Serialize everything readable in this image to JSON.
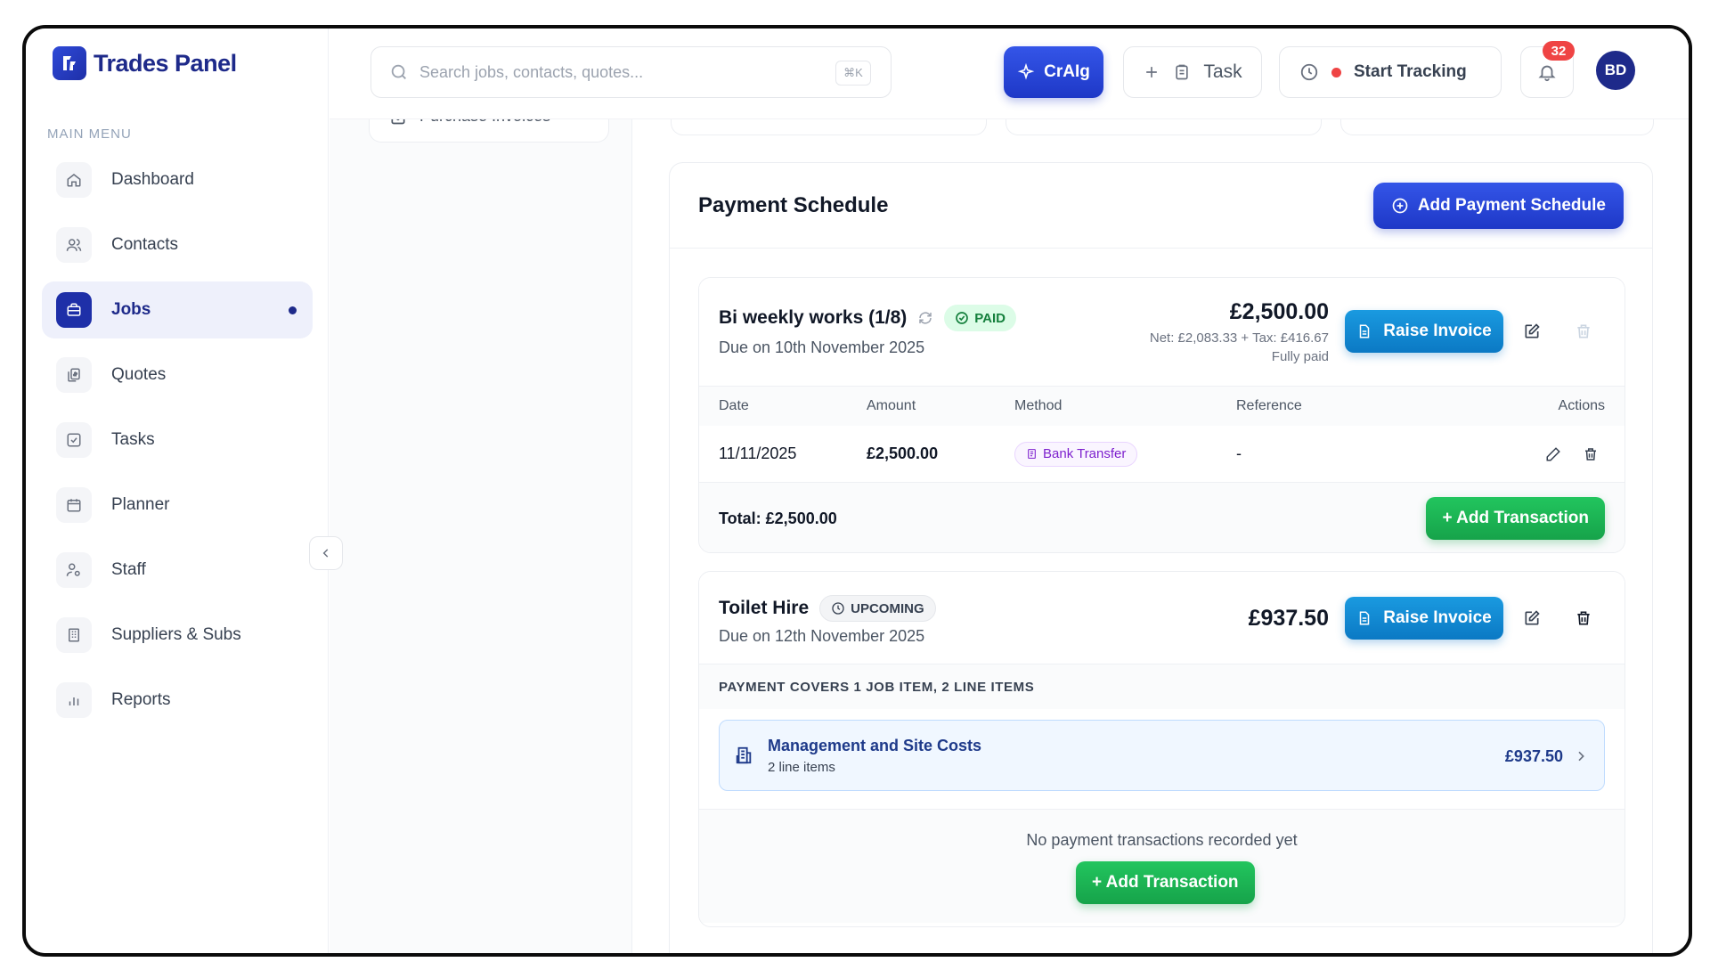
{
  "app": {
    "name": "Trades Panel",
    "brand_color": "#1e2a8a"
  },
  "sidebar": {
    "section_title": "MAIN MENU",
    "items": [
      {
        "label": "Dashboard",
        "icon": "home-icon"
      },
      {
        "label": "Contacts",
        "icon": "users-icon"
      },
      {
        "label": "Jobs",
        "icon": "briefcase-icon",
        "active": true
      },
      {
        "label": "Quotes",
        "icon": "copy-dollar-icon"
      },
      {
        "label": "Tasks",
        "icon": "check-square-icon"
      },
      {
        "label": "Planner",
        "icon": "calendar-icon"
      },
      {
        "label": "Staff",
        "icon": "user-gear-icon"
      },
      {
        "label": "Suppliers & Subs",
        "icon": "building-icon"
      },
      {
        "label": "Reports",
        "icon": "bar-chart-icon"
      }
    ]
  },
  "subpanel": {
    "item_label": "Purchase Invoices"
  },
  "topbar": {
    "search_placeholder": "Search jobs, contacts, quotes...",
    "search_shortcut": "⌘K",
    "craig_label": "CrAIg",
    "task_label": "Task",
    "tracking_label": "Start Tracking",
    "notification_count": "32",
    "avatar_initials": "BD"
  },
  "payment_schedule": {
    "title": "Payment Schedule",
    "add_button": "Add Payment Schedule",
    "schedules": [
      {
        "name": "Bi weekly works (1/8)",
        "status": "PAID",
        "due": "Due on 10th November 2025",
        "amount": "£2,500.00",
        "net_tax": "Net: £2,083.33 + Tax: £416.67",
        "paid_status": "Fully paid",
        "raise_invoice": "Raise Invoice",
        "table": {
          "headers": [
            "Date",
            "Amount",
            "Method",
            "Reference",
            "Actions"
          ],
          "rows": [
            {
              "date": "11/11/2025",
              "amount": "£2,500.00",
              "method": "Bank Transfer",
              "reference": "-"
            }
          ]
        },
        "total": "Total: £2,500.00",
        "add_transaction": "+ Add Transaction"
      },
      {
        "name": "Toilet Hire",
        "status": "UPCOMING",
        "due": "Due on 12th November 2025",
        "amount": "£937.50",
        "raise_invoice": "Raise Invoice",
        "covers": "PAYMENT COVERS 1 JOB ITEM, 2 LINE ITEMS",
        "job_item": {
          "title": "Management and Site Costs",
          "sub": "2 line items",
          "amount": "£937.50"
        },
        "empty_text": "No payment transactions recorded yet",
        "add_transaction": "+ Add Transaction"
      }
    ]
  }
}
